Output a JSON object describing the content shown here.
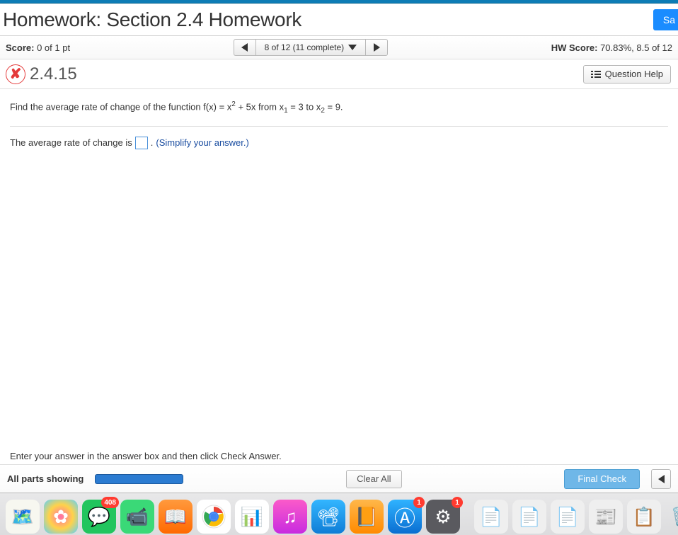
{
  "header": {
    "title": "Homework: Section 2.4 Homework",
    "save_label": "Sa"
  },
  "scorebar": {
    "score_label": "Score:",
    "score_value": "0 of 1 pt",
    "nav_text": "8 of 12 (11 complete)",
    "hw_label": "HW Score:",
    "hw_value": "70.83%, 8.5 of 12"
  },
  "question": {
    "number": "2.4.15",
    "help_label": "Question Help"
  },
  "problem": {
    "prefix": "Find the average rate of change of the function f(x) = x",
    "exp": "2",
    "mid": " + 5x from x",
    "sub1": "1",
    "eq1": " = 3 to x",
    "sub2": "2",
    "eq2": " = 9."
  },
  "answer": {
    "label": "The average rate of change is",
    "period": ".",
    "hint": "(Simplify your answer.)"
  },
  "instruction": "Enter your answer in the answer box and then click Check Answer.",
  "bottom": {
    "parts_label": "All parts showing",
    "clear_label": "Clear All",
    "final_label": "Final Check"
  },
  "dock": {
    "badges": {
      "messages": "408",
      "appstore": "1",
      "settings": "1"
    }
  }
}
